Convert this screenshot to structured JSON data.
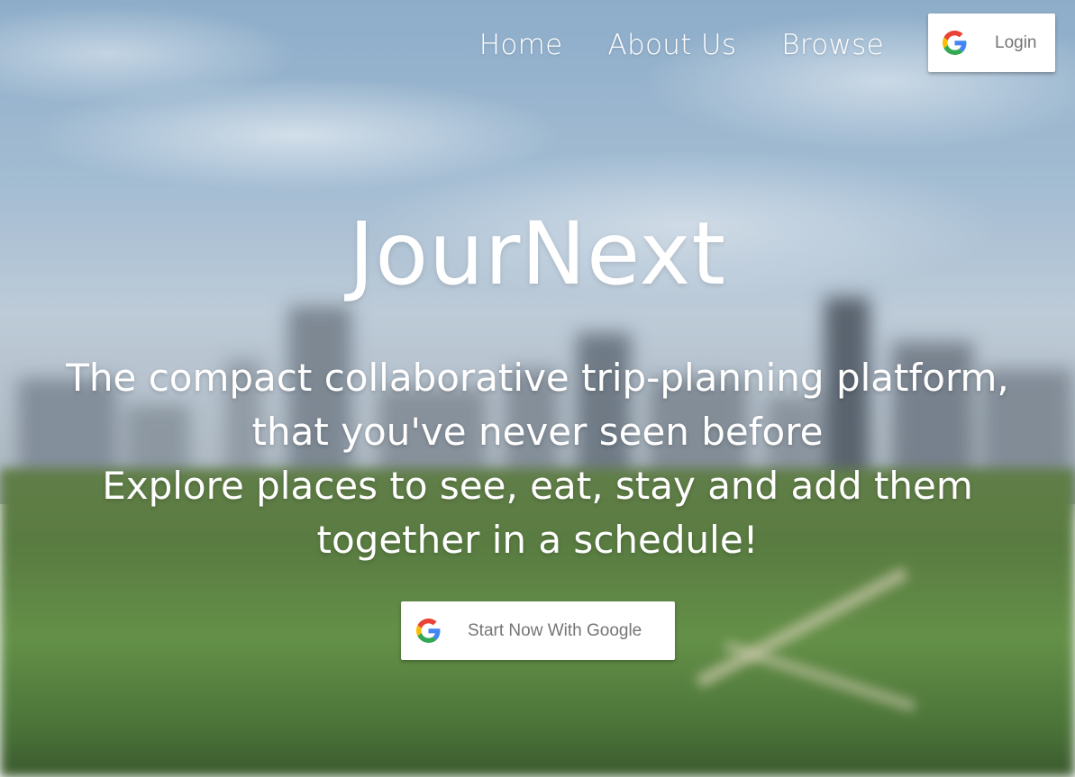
{
  "nav": {
    "links": [
      {
        "label": "Home"
      },
      {
        "label": "About Us"
      },
      {
        "label": "Browse"
      }
    ],
    "login_label": "Login"
  },
  "hero": {
    "title": "JourNext",
    "subtitle_lines": [
      "The compact collaborative trip-planning platform,",
      "that you've never seen before",
      "Explore places to see, eat, stay and add them",
      "together in a schedule!"
    ],
    "cta_label": "Start Now With Google"
  },
  "icons": {
    "login": "google-icon",
    "cta": "google-icon"
  },
  "colors": {
    "text": "#ffffff",
    "button_bg": "#ffffff",
    "button_text": "#757575",
    "google_blue": "#4285F4",
    "google_red": "#EA4335",
    "google_yellow": "#FBBC05",
    "google_green": "#34A853"
  }
}
